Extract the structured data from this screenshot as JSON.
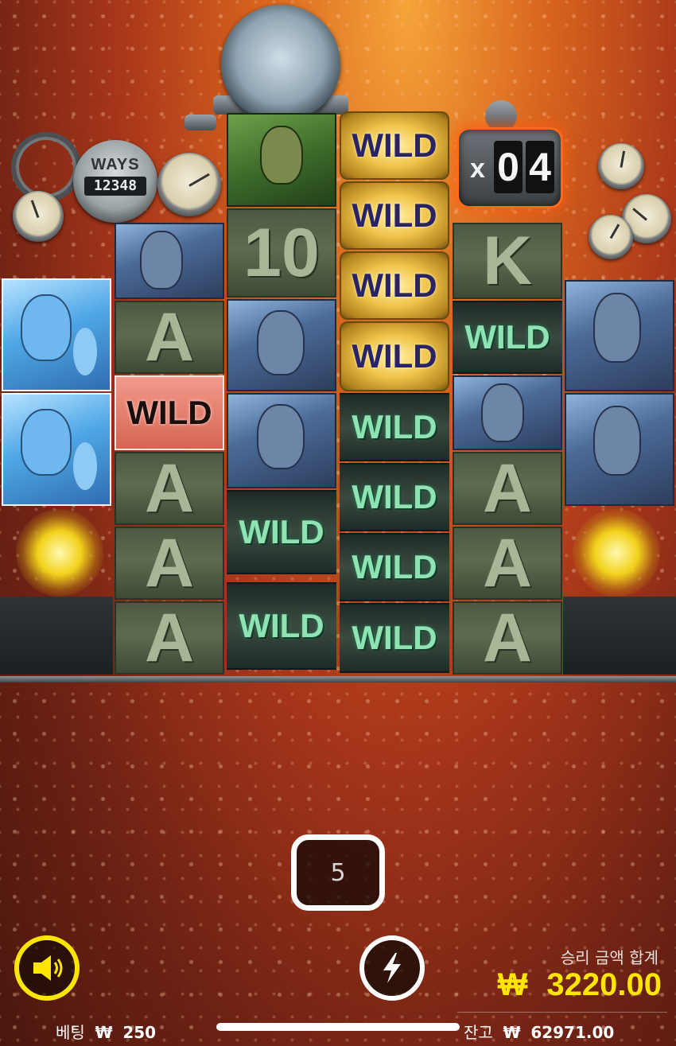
{
  "ways": {
    "label": "WAYS",
    "count": "12348"
  },
  "multiplier": {
    "x": "x",
    "digits": [
      "0",
      "4"
    ]
  },
  "reels": {
    "col0": [
      "hero-bright",
      "hero-bright"
    ],
    "col1": [
      "hero",
      "A",
      "WILD",
      "A",
      "A",
      "A"
    ],
    "col2": [
      "worker",
      "10",
      "hero",
      "hero",
      "WILD",
      "WILD"
    ],
    "col3": [
      "WILD",
      "WILD",
      "WILD",
      "WILD",
      "WILD",
      "WILD",
      "WILD",
      "WILD"
    ],
    "col4": [
      "K",
      "WILD",
      "hero",
      "A",
      "A",
      "A"
    ],
    "col5": [
      "hero",
      "hero"
    ]
  },
  "wild_text": "WILD",
  "symbols": {
    "a": "A",
    "ten": "10",
    "k": "K"
  },
  "spin_counter": "5",
  "win": {
    "label": "승리 금액 합계",
    "currency": "₩",
    "amount": "3220.00"
  },
  "bet": {
    "label": "베팅",
    "currency": "₩",
    "amount": "250"
  },
  "balance": {
    "label": "잔고",
    "currency": "₩",
    "amount": "62971.00"
  },
  "icons": {
    "sound": "speaker-icon",
    "turbo": "lightning-icon"
  },
  "colors": {
    "accent": "#ffe600",
    "multiplier_glow": "#ff6a1a"
  }
}
